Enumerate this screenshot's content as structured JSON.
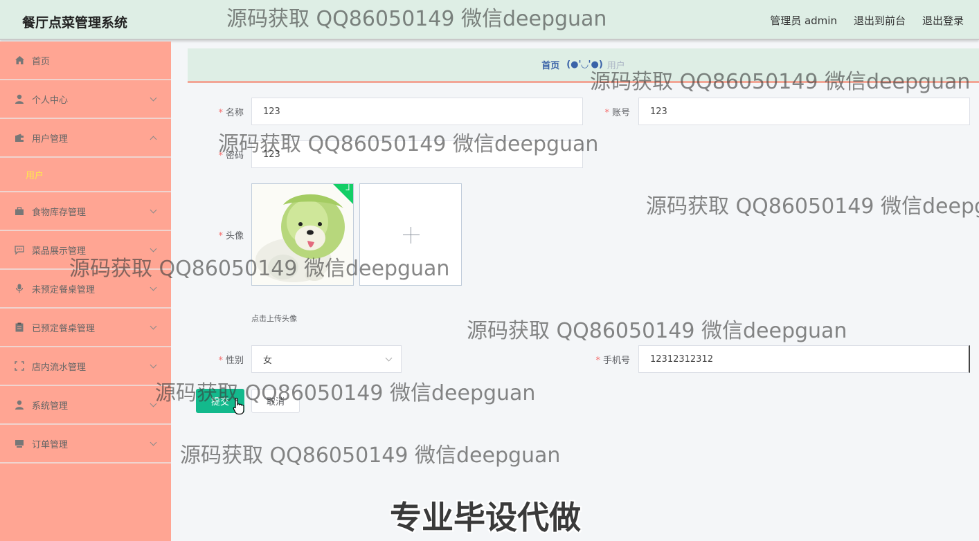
{
  "header": {
    "app_title": "餐厅点菜管理系统",
    "user_label": "管理员 admin",
    "to_front": "退出到前台",
    "logout": "退出登录"
  },
  "sidebar": {
    "items": [
      {
        "label": "首页",
        "icon": "home-icon"
      },
      {
        "label": "个人中心",
        "icon": "user-icon"
      },
      {
        "label": "用户管理",
        "icon": "wallet-icon",
        "expanded": true,
        "sub": [
          "用户"
        ]
      },
      {
        "label": "食物库存管理",
        "icon": "briefcase-icon"
      },
      {
        "label": "菜品展示管理",
        "icon": "chat-icon"
      },
      {
        "label": "未预定餐桌管理",
        "icon": "microphone-icon"
      },
      {
        "label": "已预定餐桌管理",
        "icon": "clipboard-icon"
      },
      {
        "label": "店内流水管理",
        "icon": "scan-icon"
      },
      {
        "label": "系统管理",
        "icon": "user-icon"
      },
      {
        "label": "订单管理",
        "icon": "cart-icon"
      }
    ],
    "colors": {
      "bg": "#ffa593",
      "active_sub": "#ffe94a"
    }
  },
  "breadcrumb": {
    "home": "首页",
    "separator": "(●'◡'●)",
    "current": "用户"
  },
  "form": {
    "name": {
      "label": "名称",
      "value": "123"
    },
    "account": {
      "label": "账号",
      "value": "123"
    },
    "password": {
      "label": "密码",
      "value": "123"
    },
    "avatar": {
      "label": "头像",
      "hint": "点击上传头像"
    },
    "gender": {
      "label": "性别",
      "value": "女"
    },
    "phone": {
      "label": "手机号",
      "value": "12312312312"
    },
    "submit": "提交",
    "cancel": "取消"
  },
  "watermark": "源码获取 QQ86050149 微信deepguan",
  "watermark_cut": "源码获取 QQ86050149 微信deepg",
  "ad_text": "专业毕设代做",
  "accent": "#13b98c"
}
